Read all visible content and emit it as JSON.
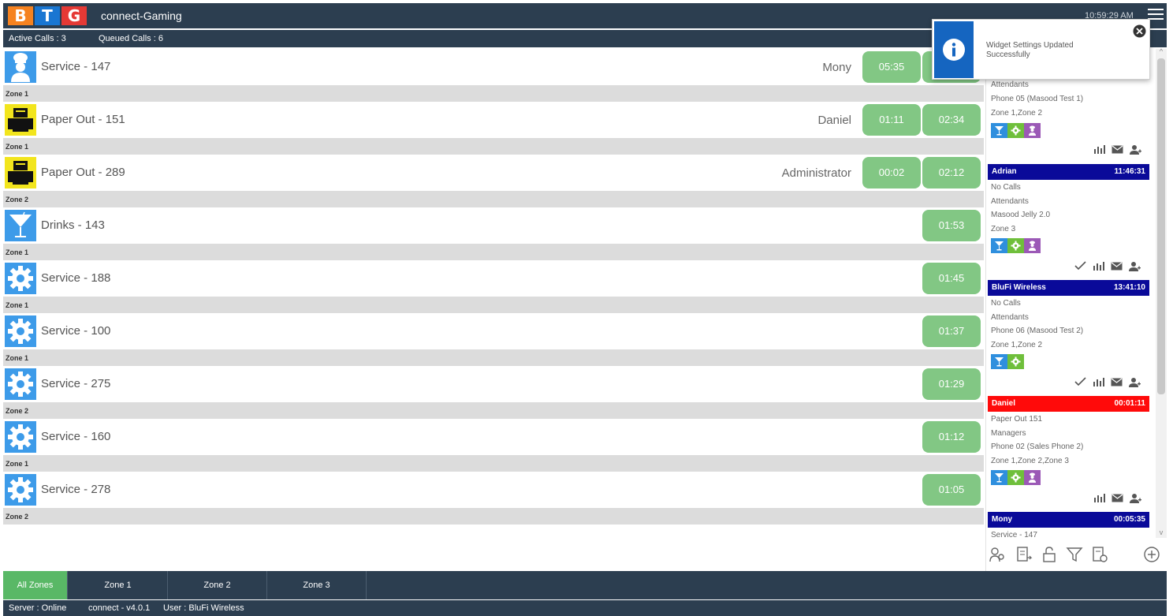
{
  "header": {
    "logo_letters": [
      "B",
      "T",
      "G"
    ],
    "title": "connect-Gaming",
    "clock": "10:59:29 AM",
    "menu_icon": "hamburger-icon"
  },
  "summary": {
    "active_calls": "Active Calls : 3",
    "queued_calls": "Queued Calls : 6"
  },
  "calls": [
    {
      "icon": "chef-icon",
      "label": "Service - 147",
      "person": "Mony",
      "timers": [
        "05:35",
        ""
      ],
      "zone": "Zone 1"
    },
    {
      "icon": "printer-icon",
      "label": "Paper Out - 151",
      "person": "Daniel",
      "timers": [
        "01:11",
        "02:34"
      ],
      "zone": "Zone 1"
    },
    {
      "icon": "printer-icon",
      "label": "Paper Out - 289",
      "person": "Administrator",
      "timers": [
        "00:02",
        "02:12"
      ],
      "zone": "Zone 2"
    },
    {
      "icon": "cocktail-icon",
      "label": "Drinks - 143",
      "person": "",
      "timers": [
        "01:53"
      ],
      "zone": "Zone 1"
    },
    {
      "icon": "gear-icon",
      "label": "Service - 188",
      "person": "",
      "timers": [
        "01:45"
      ],
      "zone": "Zone 1"
    },
    {
      "icon": "gear-icon",
      "label": "Service - 100",
      "person": "",
      "timers": [
        "01:37"
      ],
      "zone": "Zone 1"
    },
    {
      "icon": "gear-icon",
      "label": "Service - 275",
      "person": "",
      "timers": [
        "01:29"
      ],
      "zone": "Zone 2"
    },
    {
      "icon": "gear-icon",
      "label": "Service - 160",
      "person": "",
      "timers": [
        "01:12"
      ],
      "zone": "Zone 1"
    },
    {
      "icon": "gear-icon",
      "label": "Service - 278",
      "person": "",
      "timers": [
        "01:05"
      ],
      "zone": "Zone 2"
    }
  ],
  "attendants": {
    "first_partial": {
      "role": "Attendants",
      "device": "Phone 05 (Masood Test 1)",
      "zones": "Zone 1,Zone 2"
    },
    "adrian": {
      "name": "Adrian",
      "time": "11:46:31",
      "status": "No Calls",
      "role": "Attendants",
      "device": "Masood Jelly 2.0",
      "zones": "Zone 3"
    },
    "blufi": {
      "name": "BluFi Wireless",
      "time": "13:41:10",
      "status": "No Calls",
      "role": "Attendants",
      "device": "Phone 06 (Masood Test 2)",
      "zones": "Zone 1,Zone 2"
    },
    "daniel": {
      "name": "Daniel",
      "time": "00:01:11",
      "status": "Paper Out 151",
      "role": "Managers",
      "device": "Phone 02 (Sales Phone 2)",
      "zones": "Zone 1,Zone 2,Zone 3"
    },
    "mony": {
      "name": "Mony",
      "time": "00:05:35",
      "status": "Service - 147"
    }
  },
  "notification": {
    "message": "Widget Settings Updated Successfully",
    "icon": "info-icon"
  },
  "zone_tabs": [
    "All Zones",
    "Zone 1",
    "Zone 2",
    "Zone 3"
  ],
  "status": {
    "server": "Server : Online",
    "version": "connect - v4.0.1",
    "user": "User : BluFi Wireless"
  },
  "colors": {
    "header_bg": "#2c3e50",
    "timer_green": "#82c784",
    "active_tab": "#59b866",
    "attendant_navy": "#0a0a99",
    "attendant_red": "#ff0a0a",
    "info_blue": "#1565c0"
  }
}
